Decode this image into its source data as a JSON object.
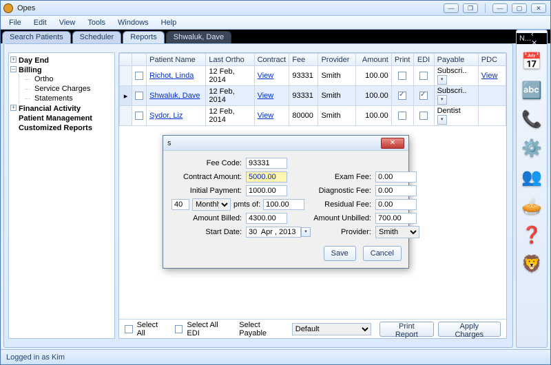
{
  "app": {
    "title": "Opes"
  },
  "menu": [
    "File",
    "Edit",
    "View",
    "Tools",
    "Windows",
    "Help"
  ],
  "tabs": [
    "Search Patients",
    "Scheduler",
    "Reports",
    "Shwaluk, Dave"
  ],
  "side_header": "N...",
  "nav": {
    "day_end": "Day End",
    "billing": "Billing",
    "billing_children": [
      "Ortho",
      "Service Charges",
      "Statements"
    ],
    "financial": "Financial Activity",
    "patient_mgmt": "Patient Management",
    "custom_reports": "Customized Reports"
  },
  "table": {
    "headers": [
      "",
      "",
      "Patient Name",
      "Last Ortho",
      "Contract",
      "Fee",
      "Provider",
      "Amount",
      "Print",
      "EDI",
      "Payable",
      "PDC"
    ],
    "rows": [
      {
        "name": "Richot, Linda",
        "last": "12 Feb, 2014",
        "contract": "View",
        "fee": "93331",
        "provider": "Smith",
        "amount": "100.00",
        "print": false,
        "edi": false,
        "payable": "Subscri...",
        "pdc": "View"
      },
      {
        "name": "Shwaluk, Dave",
        "last": "12 Feb, 2014",
        "contract": "View",
        "fee": "93331",
        "provider": "Smith",
        "amount": "100.00",
        "print": true,
        "edi": true,
        "payable": "Subscri...",
        "pdc": ""
      },
      {
        "name": "Sydor, Liz",
        "last": "12 Feb, 2014",
        "contract": "View",
        "fee": "80000",
        "provider": "Smith",
        "amount": "100.00",
        "print": false,
        "edi": false,
        "payable": "Dentist",
        "pdc": ""
      }
    ]
  },
  "footer": {
    "select_all": "Select All",
    "select_all_edi": "Select All EDI",
    "select_payable": "Select Payable",
    "payable_value": "Default",
    "print_report": "Print Report",
    "apply_charges": "Apply Charges"
  },
  "dialog": {
    "title": "s",
    "labels": {
      "fee_code": "Fee Code:",
      "contract_amount": "Contract Amount:",
      "initial_payment": "Initial Payment:",
      "monthly": "Monthly",
      "pmts_of": "pmts of:",
      "amount_billed": "Amount Billed:",
      "start_date": "Start Date:",
      "exam_fee": "Exam Fee:",
      "diagnostic_fee": "Diagnostic Fee:",
      "residual_fee": "Residual Fee:",
      "amount_unbilled": "Amount Unbilled:",
      "provider": "Provider:",
      "save": "Save",
      "cancel": "Cancel"
    },
    "values": {
      "fee_code": "93331",
      "contract_amount": "5000.00",
      "initial_payment": "1000.00",
      "n_payments": "40",
      "pmts_of": "100.00",
      "amount_billed": "4300.00",
      "start_date": "30  Apr , 2013",
      "exam_fee": "0.00",
      "diagnostic_fee": "0.00",
      "residual_fee": "0.00",
      "amount_unbilled": "700.00",
      "provider": "Smith"
    }
  },
  "status": "Logged in as Kim"
}
